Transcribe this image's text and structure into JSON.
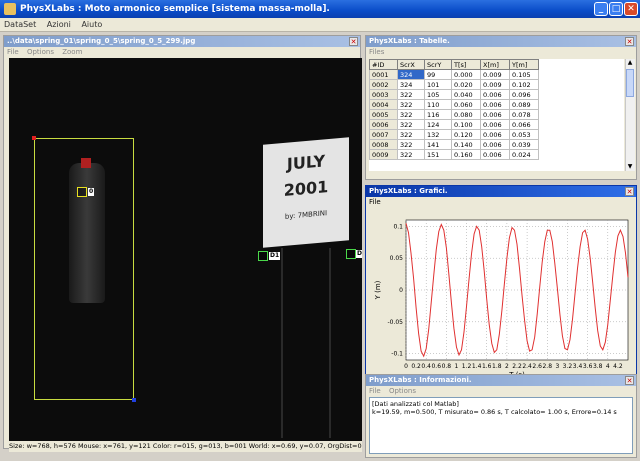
{
  "window": {
    "title": "PhysXLabs :  Moto armonico semplice [sistema massa-molla]."
  },
  "menu": {
    "items": [
      "DataSet",
      "Azioni",
      "Aiuto"
    ]
  },
  "video_window": {
    "title": "..\\data\\spring_01\\spring_0_5\\spring_0_5_299.jpg",
    "menu": [
      "File",
      "Options",
      "Zoom"
    ],
    "sign_line1": "JULY",
    "sign_line2": "2001",
    "sign_line3": "by: 7MBRINI",
    "marker_labels": [
      "0",
      "D1",
      "D"
    ],
    "status": "Size: w=768, h=576 Mouse: x=761, y=121 Color: r=015, g=013, b=001  World: x=0.69, y=0.07, OrgDist=0.69"
  },
  "table_window": {
    "title": "PhysXLabs :  Tabelle.",
    "menu": [
      "Files"
    ],
    "headers": [
      "#ID",
      "ScrX",
      "ScrY",
      "T[s]",
      "X[m]",
      "Y[m]"
    ],
    "rows": [
      [
        "0001",
        "324",
        "99",
        "0.000",
        "0.009",
        "0.105"
      ],
      [
        "0002",
        "324",
        "101",
        "0.020",
        "0.009",
        "0.102"
      ],
      [
        "0003",
        "322",
        "105",
        "0.040",
        "0.006",
        "0.096"
      ],
      [
        "0004",
        "322",
        "110",
        "0.060",
        "0.006",
        "0.089"
      ],
      [
        "0005",
        "322",
        "116",
        "0.080",
        "0.006",
        "0.078"
      ],
      [
        "0006",
        "322",
        "124",
        "0.100",
        "0.006",
        "0.066"
      ],
      [
        "0007",
        "322",
        "132",
        "0.120",
        "0.006",
        "0.053"
      ],
      [
        "0008",
        "322",
        "141",
        "0.140",
        "0.006",
        "0.039"
      ],
      [
        "0009",
        "322",
        "151",
        "0.160",
        "0.006",
        "0.024"
      ]
    ]
  },
  "chart_window": {
    "title": "PhysXLabs :  Grafici.",
    "menu": [
      "File"
    ]
  },
  "info_window": {
    "title": "PhysXLabs :  Informazioni.",
    "menu": [
      "File",
      "Options"
    ],
    "line1": "[Dati analizzati col Matlab]",
    "line2": "k=19.59, m=0.500, T misurato= 0.86 s, T calcolato= 1.00 s,  Errore=0.14 s"
  },
  "colors": {
    "series": "#e03030",
    "title_active": "#0a36a8"
  },
  "chart_data": {
    "type": "line",
    "xlabel": "T (s)",
    "ylabel": "Y (m)",
    "xlim": [
      0,
      4.4
    ],
    "ylim": [
      -0.11,
      0.11
    ],
    "xticks": [
      "0",
      "0.2",
      "0.4",
      "0.6",
      "0.8",
      "1",
      "1.2",
      "1.4",
      "1.6",
      "1.8",
      "2",
      "2.2",
      "2.4",
      "2.6",
      "2.8",
      "3",
      "3.2",
      "3.4",
      "3.6",
      "3.8",
      "4",
      "4.2"
    ],
    "yticks": [
      "0.1",
      "0.05",
      "0",
      "-0.05",
      "-0.1"
    ],
    "grid": true,
    "series": [
      {
        "x": [
          0,
          0.05,
          0.1,
          0.15,
          0.2,
          0.25,
          0.3,
          0.35,
          0.4,
          0.45,
          0.5,
          0.55,
          0.6,
          0.65,
          0.7,
          0.75,
          0.8,
          0.85,
          0.9,
          0.95,
          1,
          1.05,
          1.1,
          1.15,
          1.2,
          1.25,
          1.3,
          1.35,
          1.4,
          1.45,
          1.5,
          1.55,
          1.6,
          1.65,
          1.7,
          1.75,
          1.8,
          1.85,
          1.9,
          1.95,
          2,
          2.05,
          2.1,
          2.15,
          2.2,
          2.25,
          2.3,
          2.35,
          2.4,
          2.45,
          2.5,
          2.55,
          2.6,
          2.65,
          2.7,
          2.75,
          2.8,
          2.85,
          2.9,
          2.95,
          3,
          3.05,
          3.1,
          3.15,
          3.2,
          3.25,
          3.3,
          3.35,
          3.4,
          3.45,
          3.5,
          3.55,
          3.6,
          3.65,
          3.7,
          3.75,
          3.8,
          3.85,
          3.9,
          3.95,
          4,
          4.05,
          4.1,
          4.15,
          4.2,
          4.25,
          4.3,
          4.35,
          4.4
        ],
        "y": [
          0.105,
          0.09,
          0.058,
          0.018,
          -0.028,
          -0.068,
          -0.096,
          -0.104,
          -0.092,
          -0.062,
          -0.02,
          0.024,
          0.064,
          0.092,
          0.103,
          0.094,
          0.066,
          0.024,
          -0.02,
          -0.06,
          -0.09,
          -0.102,
          -0.094,
          -0.066,
          -0.026,
          0.018,
          0.058,
          0.088,
          0.1,
          0.094,
          0.068,
          0.03,
          -0.014,
          -0.054,
          -0.084,
          -0.098,
          -0.094,
          -0.07,
          -0.032,
          0.01,
          0.05,
          0.082,
          0.098,
          0.094,
          0.072,
          0.034,
          -0.008,
          -0.048,
          -0.08,
          -0.096,
          -0.094,
          -0.074,
          -0.038,
          0.004,
          0.044,
          0.076,
          0.094,
          0.094,
          0.076,
          0.042,
          0.002,
          -0.038,
          -0.072,
          -0.092,
          -0.094,
          -0.078,
          -0.046,
          -0.006,
          0.034,
          0.068,
          0.09,
          0.094,
          0.08,
          0.05,
          0.012,
          -0.028,
          -0.064,
          -0.088,
          -0.094,
          -0.082,
          -0.054,
          -0.016,
          0.024,
          0.06,
          0.085,
          0.094,
          0.084,
          0.058,
          0.02
        ]
      }
    ]
  }
}
